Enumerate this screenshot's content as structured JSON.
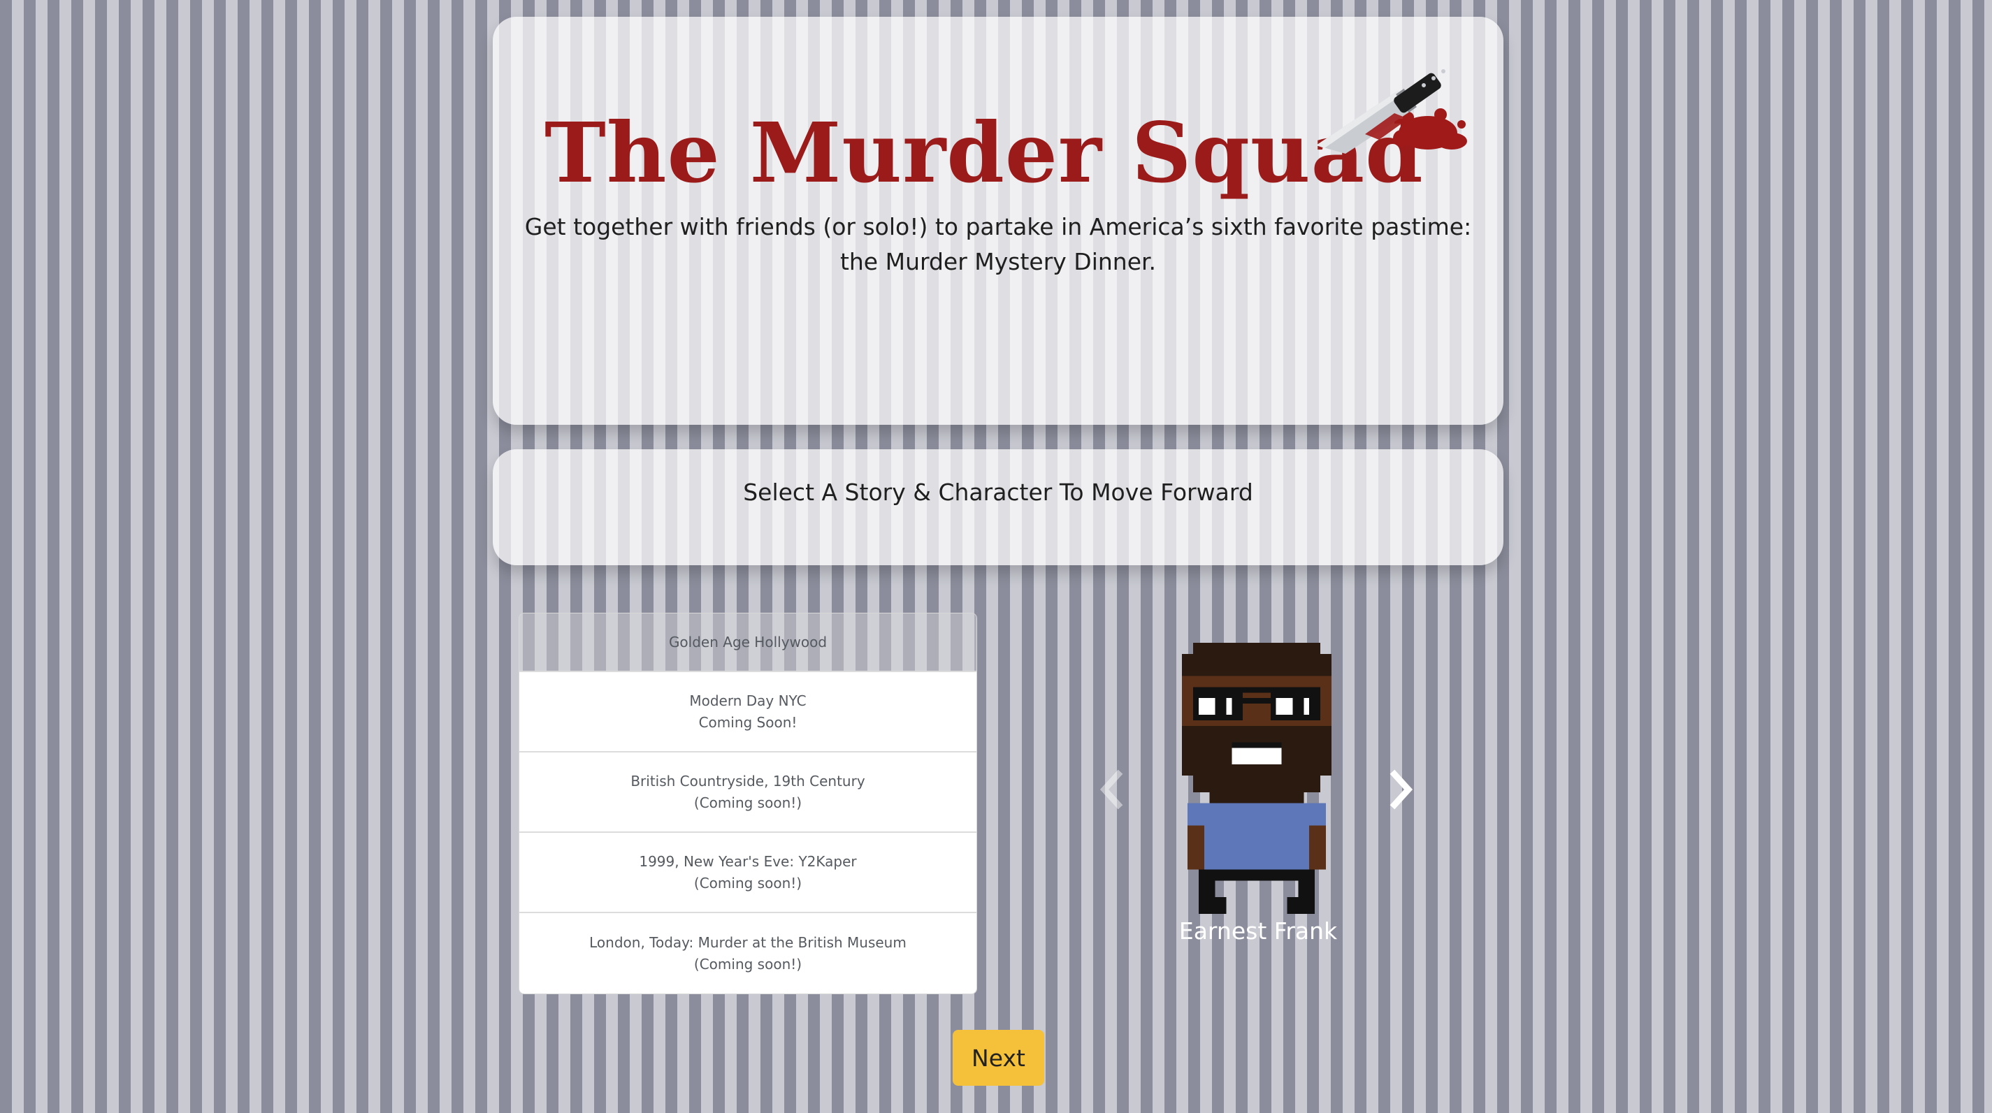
{
  "header": {
    "title": "The Murder Squad",
    "tagline_line1": "Get together with friends (or solo!) to partake in America’s sixth favorite pastime:",
    "tagline_line2": "the Murder Mystery Dinner."
  },
  "prompt": {
    "text": "Select A Story & Character To Move Forward"
  },
  "stories": [
    {
      "title": "Golden Age Hollywood",
      "status": ""
    },
    {
      "title": "Modern Day NYC",
      "status": "Coming Soon!"
    },
    {
      "title": "British Countryside, 19th Century",
      "status": "(Coming soon!)"
    },
    {
      "title": "1999, New Year's Eve: Y2Kaper",
      "status": "(Coming soon!)"
    },
    {
      "title": "London, Today: Murder at the British Museum",
      "status": "(Coming soon!)"
    }
  ],
  "character": {
    "name": "Earnest Frank"
  },
  "actions": {
    "next_label": "Next"
  },
  "colors": {
    "title_red": "#9b1b1b",
    "button_yellow": "#f6c13a",
    "shirt_blue": "#5e77b8",
    "skin_brown": "#5a3018"
  }
}
